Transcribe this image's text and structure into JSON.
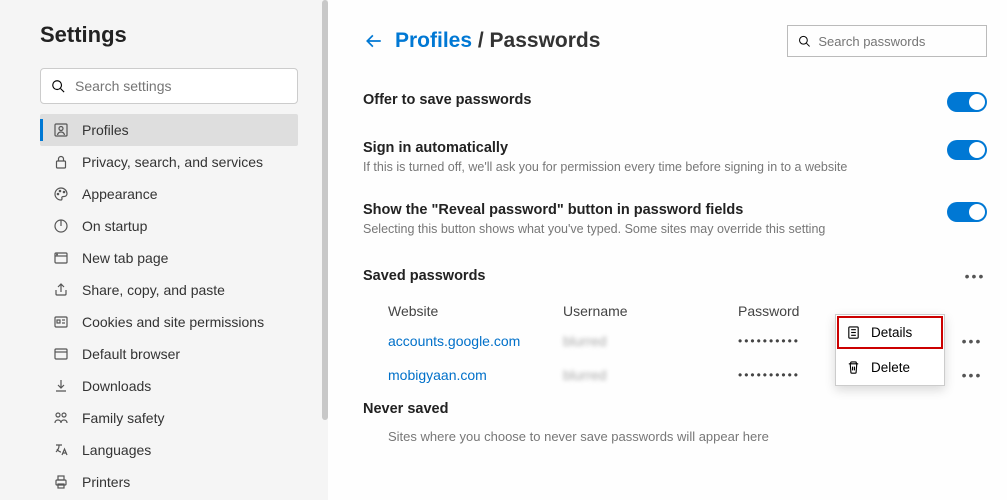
{
  "sidebar": {
    "title": "Settings",
    "search_placeholder": "Search settings",
    "items": [
      {
        "label": "Profiles"
      },
      {
        "label": "Privacy, search, and services"
      },
      {
        "label": "Appearance"
      },
      {
        "label": "On startup"
      },
      {
        "label": "New tab page"
      },
      {
        "label": "Share, copy, and paste"
      },
      {
        "label": "Cookies and site permissions"
      },
      {
        "label": "Default browser"
      },
      {
        "label": "Downloads"
      },
      {
        "label": "Family safety"
      },
      {
        "label": "Languages"
      },
      {
        "label": "Printers"
      }
    ]
  },
  "header": {
    "breadcrumb_link": "Profiles",
    "breadcrumb_sep": " / ",
    "breadcrumb_current": "Passwords",
    "search_placeholder": "Search passwords"
  },
  "settings": {
    "offer": {
      "title": "Offer to save passwords"
    },
    "signin": {
      "title": "Sign in automatically",
      "desc": "If this is turned off, we'll ask you for permission every time before signing in to a website"
    },
    "reveal": {
      "title": "Show the \"Reveal password\" button in password fields",
      "desc": "Selecting this button shows what you've typed. Some sites may override this setting"
    }
  },
  "saved": {
    "heading": "Saved passwords",
    "columns": {
      "website": "Website",
      "username": "Username",
      "password": "Password"
    },
    "rows": [
      {
        "website": "accounts.google.com",
        "username": "blurred",
        "password": "••••••••••"
      },
      {
        "website": "mobigyaan.com",
        "username": "blurred",
        "password": "••••••••••"
      }
    ]
  },
  "context_menu": {
    "details": "Details",
    "delete": "Delete"
  },
  "never": {
    "title": "Never saved",
    "desc": "Sites where you choose to never save passwords will appear here"
  }
}
